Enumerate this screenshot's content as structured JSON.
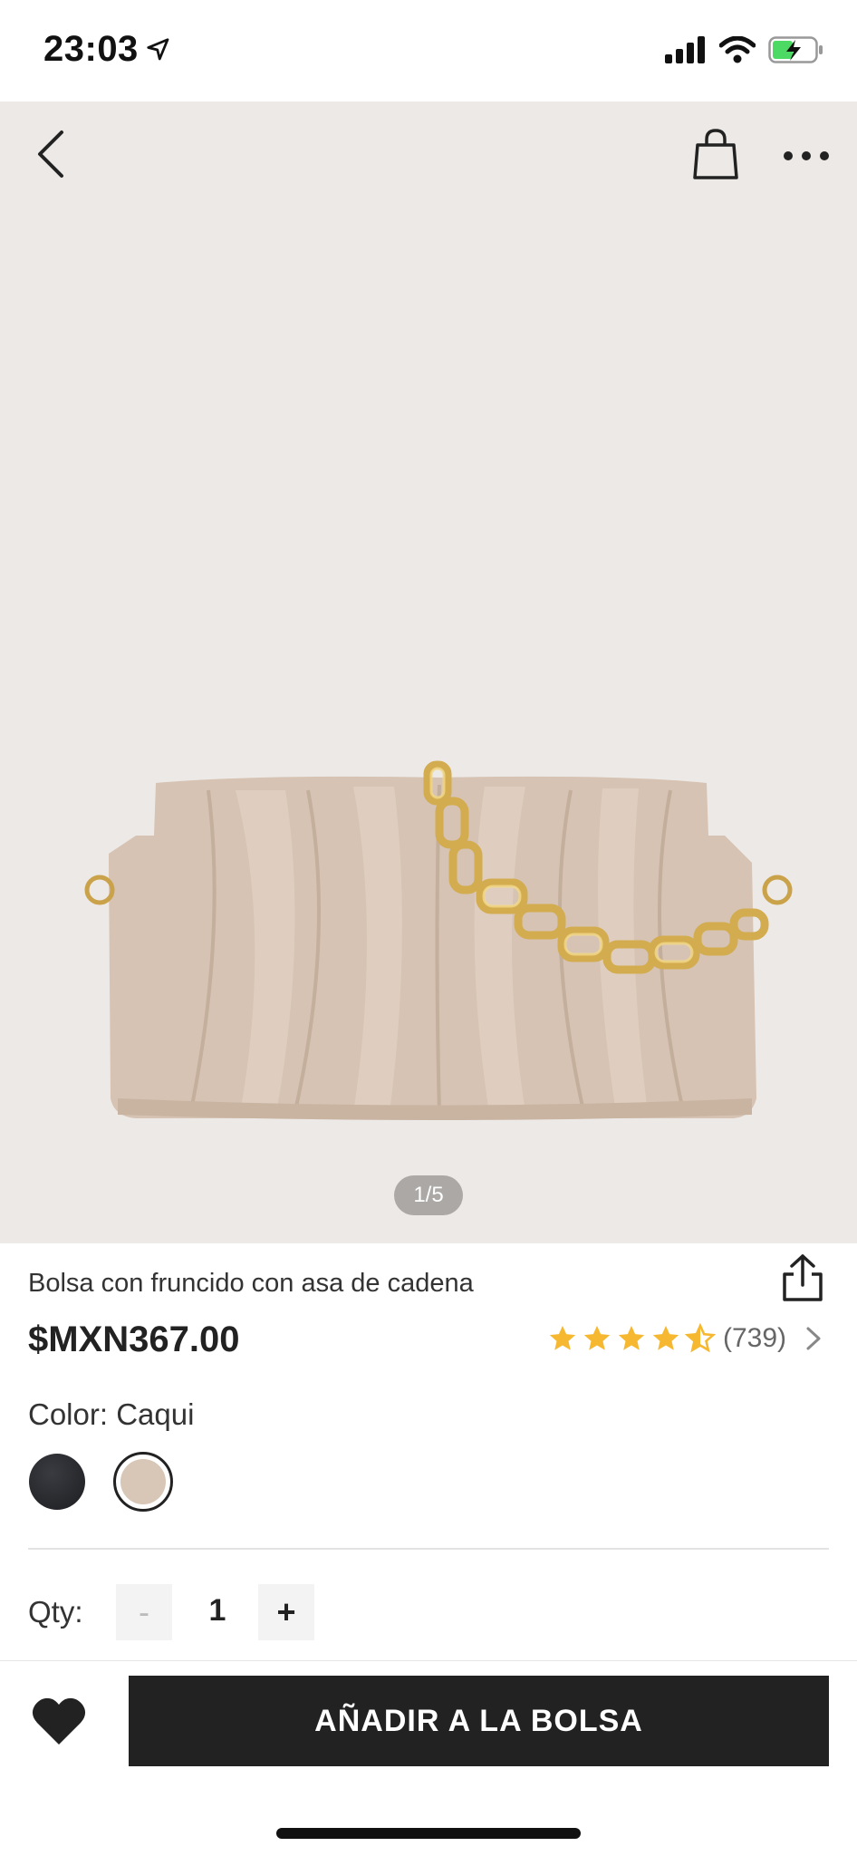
{
  "status_bar": {
    "time": "23:03"
  },
  "gallery": {
    "counter": "1/5"
  },
  "product": {
    "title": "Bolsa con fruncido con asa de cadena",
    "price": "$MXN367.00",
    "rating": 4.5,
    "review_count": "(739)"
  },
  "color": {
    "label": "Color: Caqui",
    "options": [
      "black",
      "caqui"
    ],
    "selected": "caqui"
  },
  "quantity": {
    "label": "Qty:",
    "minus": "-",
    "plus": "+",
    "value": "1"
  },
  "actions": {
    "add_to_bag": "AÑADIR A LA BOLSA"
  },
  "colors": {
    "accent_dark": "#222222",
    "star": "#f5b830",
    "image_bg": "#ede9e6",
    "khaki": "#d8c6b6"
  }
}
